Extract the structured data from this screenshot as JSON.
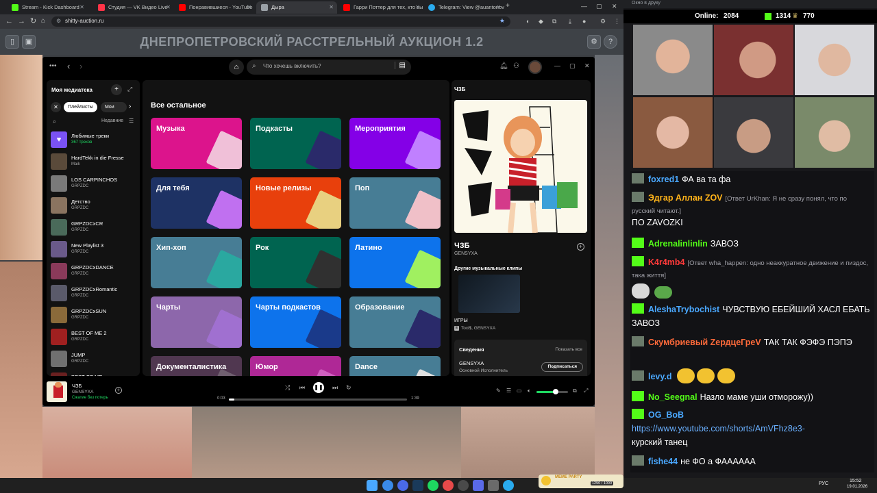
{
  "browser": {
    "tabs": [
      {
        "label": "Stream - Kick Dashboard",
        "color": "#53fc18"
      },
      {
        "label": "Студия — VK Видео Live",
        "color": "#ff3347"
      },
      {
        "label": "Понравившиеся - YouTube",
        "color": "#ff0000"
      },
      {
        "label": "Дыра",
        "color": "#9aa0a6"
      },
      {
        "label": "Гарри Поттер для тех, кто вы",
        "color": "#ff0000"
      },
      {
        "label": "Telegram: View @auantonov",
        "color": "#2aabee"
      }
    ],
    "url": "shitty-auction.ru"
  },
  "site": {
    "title": "ДНЕПРОПЕТРОВСКИЙ РАССТРЕЛЬНЫЙ АУКЦИОН 1.2"
  },
  "spotify": {
    "search_placeholder": "Что хочешь включить?",
    "library": {
      "title": "Моя медиатека",
      "chip_active": "Плейлисты",
      "chip_other": "Мои плей",
      "sort": "Недавние",
      "items": [
        {
          "name": "Любимые треки",
          "sub": "367 треков",
          "color": "#7a52f4"
        },
        {
          "name": "HardTekk in die Fresse",
          "sub": "Maik",
          "color": "#5a4a3a"
        },
        {
          "name": "LOS CARPINCHOS",
          "sub": "GRPZDC",
          "color": "#7a7a7a"
        },
        {
          "name": "Детство",
          "sub": "GRPZDC",
          "color": "#8a7460"
        },
        {
          "name": "GRPZDCxCR",
          "sub": "GRPZDC",
          "color": "#4a6a5a"
        },
        {
          "name": "New Playlist 3",
          "sub": "GRPZDC",
          "color": "#6a5a8a"
        },
        {
          "name": "GRPZDCxDANCE",
          "sub": "GRPZDC",
          "color": "#8a3a5a"
        },
        {
          "name": "GRPZDCxRomantic",
          "sub": "GRPZDC",
          "color": "#5a5a6a"
        },
        {
          "name": "GRPZDCxSUN",
          "sub": "GRPZDC",
          "color": "#8a6a3a"
        },
        {
          "name": "BEST OF ME 2",
          "sub": "GRPZDC",
          "color": "#a02020"
        },
        {
          "name": "JUMP",
          "sub": "GRPZDC",
          "color": "#707070"
        },
        {
          "name": "BEST OF ME",
          "sub": "",
          "color": "#6a2020"
        }
      ]
    },
    "browse": {
      "title": "Все остальное",
      "cards": [
        {
          "label": "Музыка",
          "color": "#dc148c",
          "art": "#f0c0d8"
        },
        {
          "label": "Подкасты",
          "color": "#006450",
          "art": "#2a2a6a"
        },
        {
          "label": "Мероприятия",
          "color": "#8400e7",
          "art": "#c080ff"
        },
        {
          "label": "Для тебя",
          "color": "#1e3264",
          "art": "#c070f0"
        },
        {
          "label": "Новые релизы",
          "color": "#e8400c",
          "art": "#e8d080"
        },
        {
          "label": "Поп",
          "color": "#477d95",
          "art": "#f0c0c8"
        },
        {
          "label": "Хип-хоп",
          "color": "#477d95",
          "art": "#2aa8a0"
        },
        {
          "label": "Рок",
          "color": "#006450",
          "art": "#303030"
        },
        {
          "label": "Латино",
          "color": "#0d73ec",
          "art": "#a0f060"
        },
        {
          "label": "Чарты",
          "color": "#8d67ab",
          "art": "#a070d0"
        },
        {
          "label": "Чарты подкастов",
          "color": "#0d73ec",
          "art": "#1a3a8a"
        },
        {
          "label": "Образование",
          "color": "#477d95",
          "art": "#2a2a6a"
        },
        {
          "label": "Документалистика",
          "color": "#503750",
          "art": "#706070"
        },
        {
          "label": "Юмор",
          "color": "#af2896",
          "art": "#d060c0"
        },
        {
          "label": "Dance",
          "color": "#477d95",
          "art": "#e0e0e0"
        }
      ]
    },
    "nowplaying": {
      "header": "ЧЗБ",
      "track": "ЧЗБ",
      "artist": "GENSYXA",
      "clips_title": "Другие музыкальные клипы",
      "clip_name": "ИГРЫ",
      "clip_artist": "Toxi$, GENSYXA",
      "clip_badge": "E",
      "details_title": "Сведения",
      "show_all": "Показать все",
      "credit_name": "GENSYXA",
      "credit_role": "Основной Исполнитель",
      "subscribe": "Подписаться"
    },
    "player": {
      "track": "ЧЗБ",
      "artist": "GENSYXA",
      "status": "Сжатие без потерь",
      "elapsed": "0:03",
      "duration": "1:39",
      "progress": 0.03,
      "volume": 0.6
    }
  },
  "stream": {
    "window_title": "Окно в друку",
    "online_label": "Online:",
    "online": "2084",
    "kick_count": "1314",
    "other_count": "770",
    "chat": [
      {
        "user": "foxred1",
        "color": "#4aa8ff",
        "badge": "cat",
        "text": "ФА ва та фа"
      },
      {
        "user": "Эдгар Аллан ZOV",
        "color": "#ffb31a",
        "badge": "cat",
        "reply": "[Ответ UrKhan: Я не сразу понял, что по русский читают.]",
        "text": "ПО ZAVOZKI"
      },
      {
        "user": "Adrenalinlinlin",
        "color": "#53fc18",
        "badge": "kick",
        "text": "ЗАВОЗ"
      },
      {
        "user": "K4r4mb4",
        "color": "#ff3a3a",
        "badge": "kick",
        "reply": "[Ответ wha_happen: одно неаккуратное движение и пиздос, така життя]",
        "text": ""
      },
      {
        "user": "AleshaTrybochist",
        "color": "#4aa8ff",
        "badge": "kick",
        "text": "ЧУВСТВУЮ ЕБЕЙШИЙ ХАСЛ ЕБАТЬ ЗАВОЗ"
      },
      {
        "user": "Скумбриевый ZердцеГреV",
        "color": "#ff6a3a",
        "badge": "cat",
        "text": "ТАК ТАК ФЭФЭ ПЭПЭ"
      },
      {
        "user": "levy.d",
        "color": "#4aa8ff",
        "badge": "cat",
        "text": ""
      },
      {
        "user": "No_Seegnal",
        "color": "#53fc18",
        "badge": "kick",
        "text": "Назло маме уши отморожу))"
      },
      {
        "user": "OG_BoB",
        "color": "#4aa8ff",
        "badge": "kick",
        "link": "https://www.youtube.com/shorts/AmVFhz8e3-",
        "text": "курский танец"
      },
      {
        "user": "fishe44",
        "color": "#4aa8ff",
        "badge": "cat",
        "text": "не ФО а ФАААААА"
      }
    ]
  },
  "taskbar": {
    "meme_label": "MEME PARTY",
    "meme_score": "1250 / 1000",
    "lang": "РУС",
    "time": "15:52",
    "date": "19.01.2026"
  }
}
